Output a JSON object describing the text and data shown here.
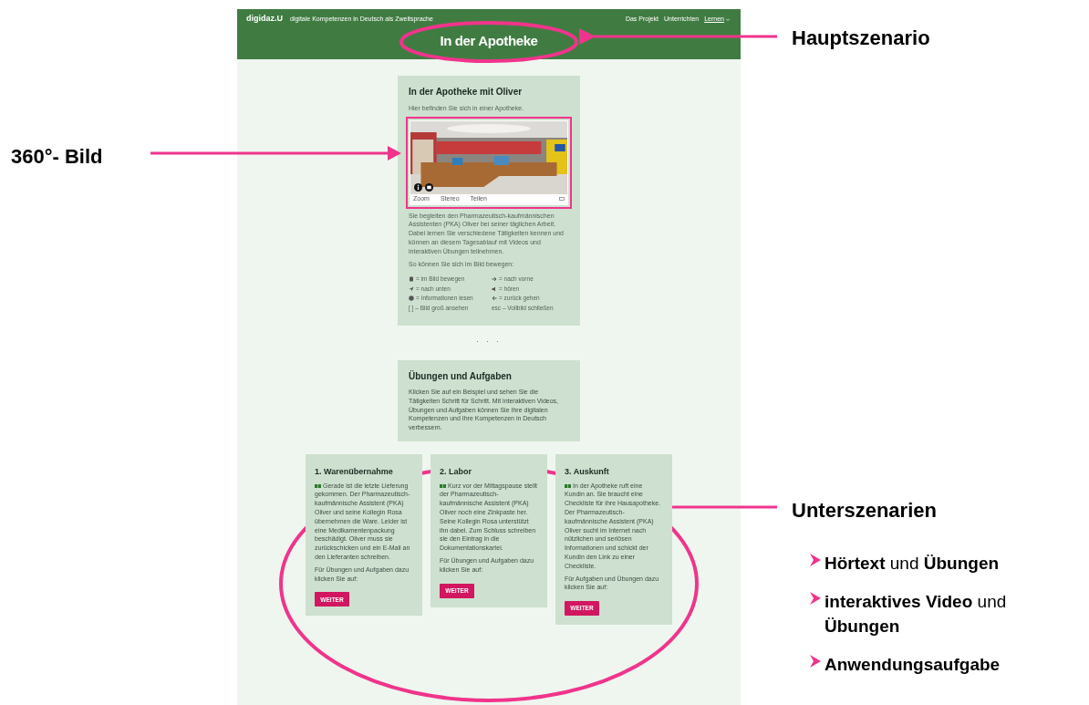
{
  "header": {
    "logo": "digidaz.U",
    "tagline": "digitale Kompetenzen in Deutsch als Zweitsprache",
    "title": "In der Apotheke",
    "nav": [
      {
        "label": "Das Projekt",
        "selected": false
      },
      {
        "label": "Unterrichten",
        "selected": false
      },
      {
        "label": "Lernen",
        "selected": true
      }
    ]
  },
  "intro_card": {
    "title": "In der Apotheke mit Oliver",
    "lead": "Hier befinden Sie sich in einer Apotheke.",
    "viewer": {
      "toolbar": [
        "Zoom",
        "Stereo",
        "Teilen"
      ]
    },
    "text": "Sie begleiten den Pharmazeutisch-kaufmännischen Assistenten (PKA) Oliver bei seiner täglichen Arbeit. Dabei lernen Sie verschiedene Tätigkeiten kennen und können an diesem Tagesablauf mit Videos und interaktiven Übungen teilnehmen.",
    "legend_title": "So können Sie sich im Bild bewegen:",
    "legend": [
      "= im Bild bewegen",
      "= nach vorne",
      "= nach unten",
      "= hören",
      "= Informationen lesen",
      "= zurück gehen",
      "[ ] – Bild groß ansehen",
      "esc – Vollbild schließen"
    ]
  },
  "separator": "· · ·",
  "exercises_card": {
    "title": "Übungen und Aufgaben",
    "text": "Klicken Sie auf ein Beispiel und sehen Sie die Tätigkeiten Schritt für Schritt. Mit interaktiven Videos, Übungen und Aufgaben können Sie Ihre digitalen Kompetenzen und Ihre Kompetenzen in Deutsch verbessern."
  },
  "scenarios": [
    {
      "title": "1. Warenübernahme",
      "text": "Gerade ist die letzte Lieferung gekommen. Der Pharmazeutisch-kaufmännische Assistent (PKA) Oliver und seine Kollegin Rosa übernehmen die Ware. Leider ist eine Medikamentenpackung beschädigt. Oliver muss sie zurückschicken und ein E-Mail an den Lieferanten schreiben.",
      "hint": "Für Übungen und Aufgaben dazu klicken Sie auf:",
      "button": "WEITER"
    },
    {
      "title": "2. Labor",
      "text": "Kurz vor der Mittagspause stellt der Pharmazeutisch-kaufmännische Assistent (PKA) Oliver noch eine Zinkpaste her. Seine Kollegin Rosa unterstützt ihn dabei. Zum Schluss schreiben sie den Eintrag in die Dokumentationskartei.",
      "hint": "Für Übungen und Aufgaben dazu klicken Sie auf:",
      "button": "WEITER"
    },
    {
      "title": "3. Auskunft",
      "text": "In der Apotheke ruft eine Kundin an. Sie braucht eine Checkliste für ihre Hausapotheke. Der Pharmazeutisch-kaufmännische Assistent (PKA) Oliver sucht im Internet nach nützlichen und seriösen Informationen und schickt der Kundin den Link zu einer Checkliste.",
      "hint": "Für Aufgaben und Übungen dazu klicken Sie auf:",
      "button": "WEITER"
    }
  ],
  "annotations": {
    "main": "Hauptszenario",
    "image": "360°- Bild",
    "sub": "Unterszenarien",
    "sub_items": [
      "**Hörtext** und **Übungen**",
      "**interaktives Video** und **Übungen**",
      "**Anwendungsaufgabe**"
    ]
  }
}
